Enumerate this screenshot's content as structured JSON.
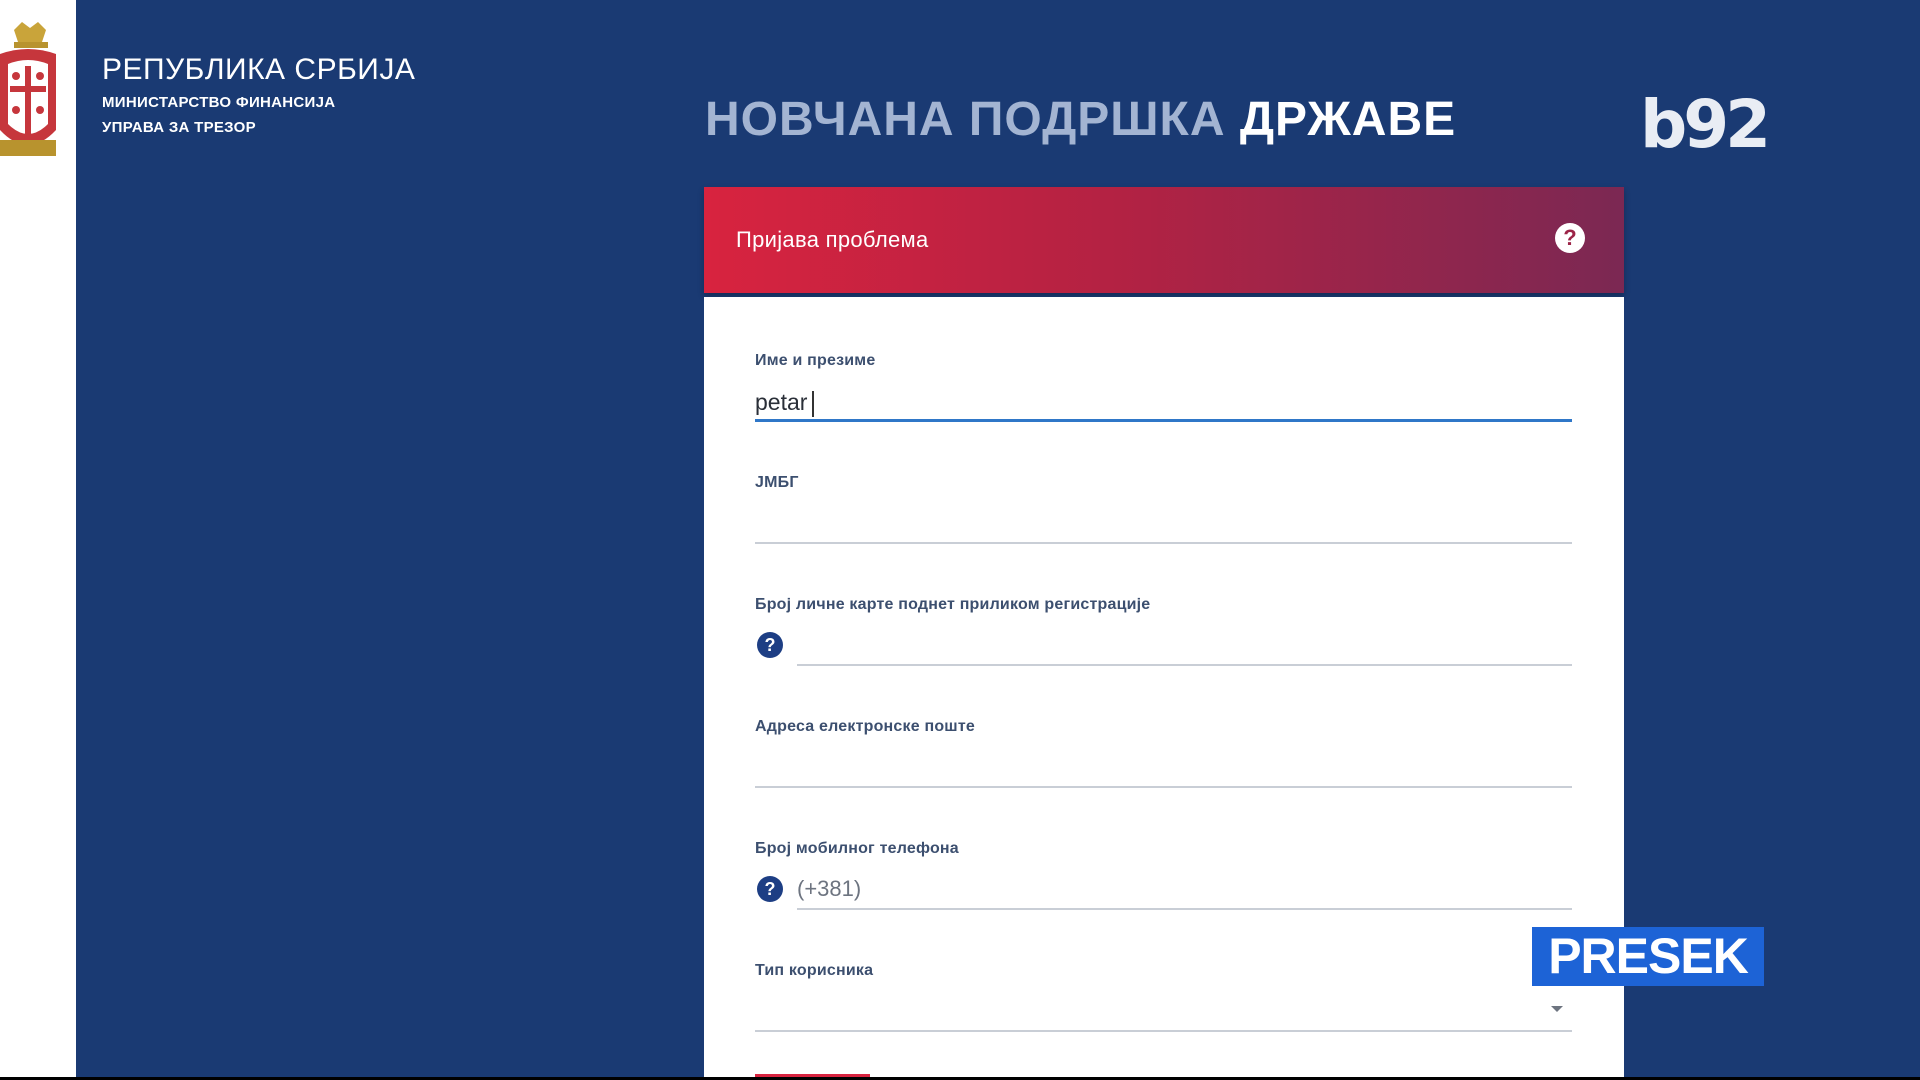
{
  "brand": {
    "country": "РЕПУБЛИКА СРБИЈА",
    "ministry": "МИНИСТАРСТВО ФИНАНСИЈА",
    "department": "УПРАВА ЗА ТРЕЗОР"
  },
  "headline": {
    "part_a": "НОВЧАНА ПОДРШКА",
    "part_b": "ДРЖАВЕ"
  },
  "channel_logo": "b92",
  "form": {
    "title": "Пријава проблема",
    "fields": [
      {
        "label": "Име и презиме",
        "value": "petar"
      },
      {
        "label": "ЈМБГ",
        "value": ""
      },
      {
        "label": "Број личне карте поднет приликом регистрације",
        "value": ""
      },
      {
        "label": "Адреса електронске поште",
        "value": ""
      },
      {
        "label": "Број мобилног телефона",
        "placeholder": "(+381)"
      },
      {
        "label": "Тип корисника",
        "value": ""
      }
    ]
  },
  "overlay_badge": "PRESEK",
  "colors": {
    "background": "#1a3a73",
    "header_gradient_start": "#d8233f",
    "header_gradient_end": "#7b2853",
    "active_underline": "#2f77c8",
    "badge": "#1d63d6"
  }
}
